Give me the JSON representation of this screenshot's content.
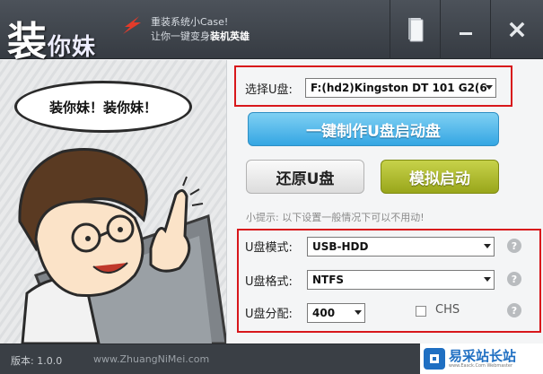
{
  "app": {
    "logo_char": "装",
    "logo_rest": "你妹",
    "slogan_line1": "重装系统小Case!",
    "slogan_line2_prefix": "让你一键变身",
    "slogan_line2_bold": "装机英雄"
  },
  "titlebar": {
    "icons": [
      "book-icon",
      "minimize-icon",
      "close-icon"
    ]
  },
  "illustration": {
    "bubble_text": "装你妹！装你妹！"
  },
  "usb_select": {
    "label": "选择U盘:",
    "value": "F:(hd2)Kingston DT 101 G2(6"
  },
  "buttons": {
    "make": "一键制作U盘启动盘",
    "restore": "还原U盘",
    "simulate": "模拟启动"
  },
  "tip": "小提示: 以下设置一般情况下可以不用动!",
  "settings": {
    "mode_label": "U盘模式:",
    "mode_value": "USB-HDD",
    "format_label": "U盘格式:",
    "format_value": "NTFS",
    "alloc_label": "U盘分配:",
    "alloc_value": "400",
    "chs_label": "CHS",
    "chs_checked": false
  },
  "status": {
    "version": "版本: 1.0.0",
    "website": "www.ZhuangNiMei.com"
  },
  "watermark": {
    "text": "易采站长站",
    "sub": "www.Easck.Com Webmaster"
  },
  "colors": {
    "titlebar": "#3f444b",
    "make_button": "#35a6e3",
    "simulate_button": "#a4b022",
    "highlight_box": "#d8171b",
    "watermark": "#1f6fc2"
  }
}
